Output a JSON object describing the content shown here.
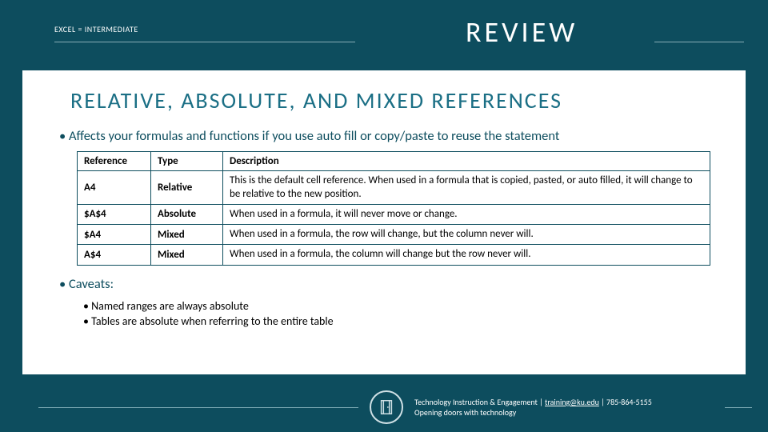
{
  "header": {
    "breadcrumb": "EXCEL = INTERMEDIATE",
    "badge": "REVIEW"
  },
  "title": "RELATIVE, ABSOLUTE, AND MIXED REFERENCES",
  "bullet1": "Affects your formulas and functions if you use auto fill or copy/paste to reuse the statement",
  "table": {
    "headers": {
      "ref": "Reference",
      "type": "Type",
      "desc": "Description"
    },
    "rows": [
      {
        "ref": "A4",
        "type": "Relative",
        "desc": "This is the default cell reference. When used in a formula that is copied, pasted, or auto filled, it will change to be relative to the new position."
      },
      {
        "ref": "$A$4",
        "type": "Absolute",
        "desc": "When used in a formula, it will never move or change."
      },
      {
        "ref": "$A4",
        "type": "Mixed",
        "desc": "When used in a formula, the row will change, but the column never will."
      },
      {
        "ref": "A$4",
        "type": "Mixed",
        "desc": "When used in a formula, the column will change but the row never will."
      }
    ]
  },
  "bullet2": "Caveats:",
  "sub1": "Named ranges are always absolute",
  "sub2": "Tables are absolute when referring to the entire table",
  "footer": {
    "line1_prefix": "Technology Instruction & Engagement | ",
    "email": "training@ku.edu",
    "line1_suffix": " | 785-864-5155",
    "line2": "Opening doors with technology"
  }
}
